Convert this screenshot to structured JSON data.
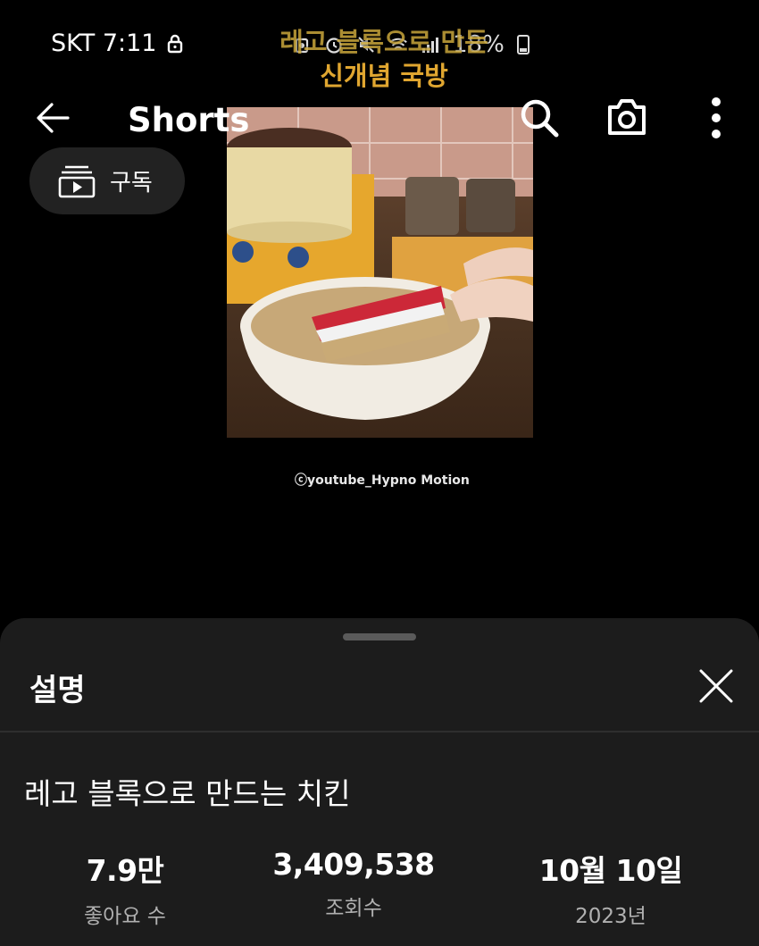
{
  "status_bar": {
    "carrier_time": "SKT 7:11",
    "battery": "18%",
    "icons": [
      "lock-icon",
      "sync-icon",
      "alarm-icon",
      "mute-icon",
      "wifi-icon",
      "signal-icon",
      "battery-icon"
    ]
  },
  "overlay_title": {
    "line1": "레고 블록으로 만든",
    "line2": "신개념 국방"
  },
  "header": {
    "back_icon": "arrow-left-icon",
    "title": "Shorts",
    "search_icon": "search-icon",
    "camera_icon": "camera-icon",
    "more_icon": "more-vertical-icon",
    "subscriptions_label": "구독"
  },
  "video": {
    "credit": "ⓒyoutube_Hypno Motion"
  },
  "description_sheet": {
    "title": "설명",
    "video_title": "레고 블록으로 만드는 치킨",
    "stats": [
      {
        "value": "7.9만",
        "label": "좋아요 수"
      },
      {
        "value": "3,409,538",
        "label": "조회수"
      },
      {
        "value": "10월 10일",
        "label": "2023년"
      }
    ]
  },
  "colors": {
    "background": "#000000",
    "sheet": "#1c1c1c",
    "pill": "#222222",
    "overlay_text": "#e0a630"
  }
}
